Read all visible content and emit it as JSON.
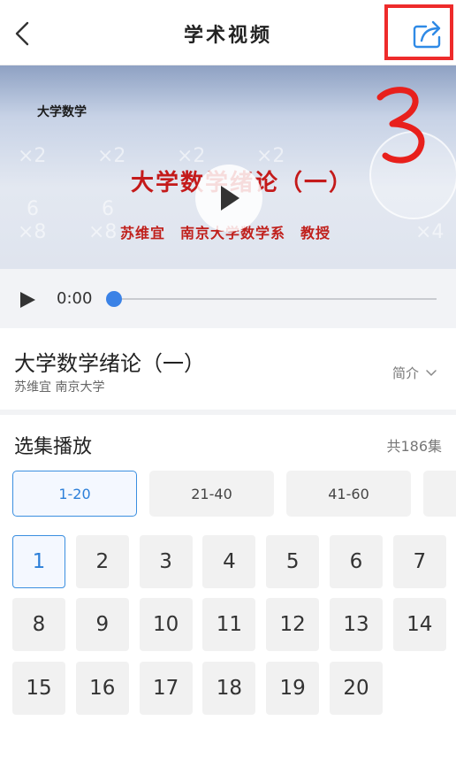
{
  "header": {
    "title": "学术视频",
    "back_icon": "chevron-left-icon",
    "share_icon": "share-icon"
  },
  "annotation": {
    "mark": "3",
    "color": "#ee2b2b"
  },
  "video": {
    "course_tag": "大学数学",
    "title_overlay": "大学数学绪论（一）",
    "subtitle_overlay": "苏维宜　南京大学数学系　教授",
    "time": "0:00",
    "progress": 0,
    "accent_color": "#3b82e6"
  },
  "info": {
    "title": "大学数学绪论（一）",
    "subtitle": "苏维宜 南京大学",
    "intro_label": "简介"
  },
  "episodes": {
    "title": "选集播放",
    "count_label": "共186集",
    "ranges": [
      "1-20",
      "21-40",
      "41-60",
      ""
    ],
    "active_range": 0,
    "items": [
      "1",
      "2",
      "3",
      "4",
      "5",
      "6",
      "7",
      "8",
      "9",
      "10",
      "11",
      "12",
      "13",
      "14",
      "15",
      "16",
      "17",
      "18",
      "19",
      "20"
    ],
    "active_item": 0
  }
}
